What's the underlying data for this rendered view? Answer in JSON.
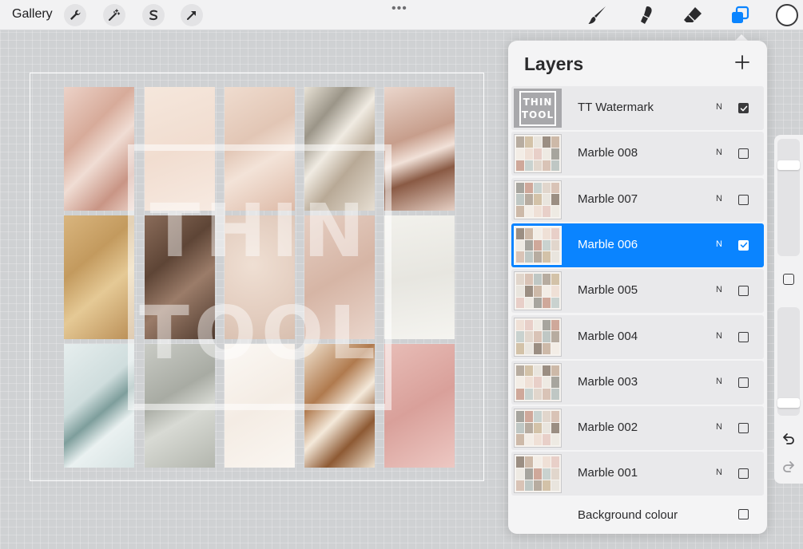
{
  "toolbar": {
    "gallery_label": "Gallery",
    "left_tools": [
      {
        "name": "actions-wrench-icon"
      },
      {
        "name": "adjustments-wand-icon"
      },
      {
        "name": "selection-s-icon"
      },
      {
        "name": "transform-arrow-icon"
      }
    ],
    "more_label": "•••",
    "right_tools": [
      "brush-icon",
      "smudge-icon",
      "eraser-icon",
      "layers-icon"
    ],
    "active_tool": "layers-icon",
    "current_color": "#ffffff",
    "accent_color": "#0a84ff"
  },
  "canvas": {
    "watermark_lines": [
      "THIN",
      "TOOL"
    ]
  },
  "layers_panel": {
    "title": "Layers",
    "add_label": "+",
    "layers": [
      {
        "name": "TT Watermark",
        "blend": "N",
        "visible": true,
        "selected": false,
        "thumb": "watermark"
      },
      {
        "name": "Marble 008",
        "blend": "N",
        "visible": false,
        "selected": false,
        "thumb": "marble"
      },
      {
        "name": "Marble 007",
        "blend": "N",
        "visible": false,
        "selected": false,
        "thumb": "marble"
      },
      {
        "name": "Marble 006",
        "blend": "N",
        "visible": true,
        "selected": true,
        "thumb": "marble"
      },
      {
        "name": "Marble 005",
        "blend": "N",
        "visible": false,
        "selected": false,
        "thumb": "marble"
      },
      {
        "name": "Marble 004",
        "blend": "N",
        "visible": false,
        "selected": false,
        "thumb": "marble"
      },
      {
        "name": "Marble 003",
        "blend": "N",
        "visible": false,
        "selected": false,
        "thumb": "marble"
      },
      {
        "name": "Marble 002",
        "blend": "N",
        "visible": false,
        "selected": false,
        "thumb": "marble"
      },
      {
        "name": "Marble 001",
        "blend": "N",
        "visible": false,
        "selected": false,
        "thumb": "marble"
      }
    ],
    "background": {
      "name": "Background colour",
      "visible": false
    },
    "thumb_watermark_lines": [
      "THIN",
      "TOOL"
    ]
  },
  "sidebar": {
    "brush_size_level": 0.8,
    "opacity_level": 0.08
  }
}
